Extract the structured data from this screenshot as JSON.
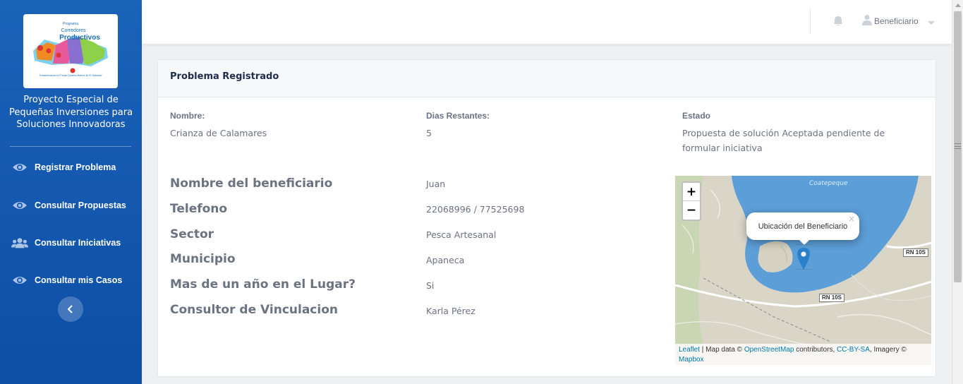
{
  "sidebar": {
    "logo": {
      "line1": "Programa",
      "line2": "Corredores",
      "line3": "Productivos",
      "tagline": "Transformando la Franja Costero-Marina de El Salvador"
    },
    "project_title": "Proyecto Especial de Pequeñas Inversiones para Soluciones Innovadoras",
    "items": [
      {
        "label": "Registrar Problema",
        "icon": "eye-icon"
      },
      {
        "label": "Consultar Propuestas",
        "icon": "eye-icon"
      },
      {
        "label": "Consultar Iniciativas",
        "icon": "users-icon"
      },
      {
        "label": "Consultar mis Casos",
        "icon": "eye-icon"
      }
    ],
    "collapse_icon": "chevron-left-icon"
  },
  "topbar": {
    "user_label": "Beneficiario",
    "bell_icon": "bell-icon",
    "user_icon": "user-icon"
  },
  "card": {
    "title": "Problema Registrado",
    "summary": [
      {
        "label": "Nombre:",
        "value": "Crianza de Calamares"
      },
      {
        "label": "Dias Restantes:",
        "value": "5"
      },
      {
        "label": "Estado",
        "value": "Propuesta de solución Aceptada pendiente de formular iniciativa"
      }
    ],
    "details": [
      {
        "label": "Nombre del beneficiario",
        "value": "Juan"
      },
      {
        "label": "Telefono",
        "value": "22068996 / 77525698"
      },
      {
        "label": "Sector",
        "value": "Pesca Artesanal"
      },
      {
        "label": "Municipio",
        "value": "Apaneca"
      },
      {
        "label": "Mas de un año en el Lugar?",
        "value": "Si"
      },
      {
        "label": "Consultor de Vinculacion",
        "value": "Karla Pérez"
      }
    ]
  },
  "map": {
    "zoom_in": "+",
    "zoom_out": "−",
    "popup_text": "Ubicación del Beneficiario",
    "popup_close": "×",
    "lake_label": "Coatepeque",
    "road_labels": [
      "RN 10S",
      "RN 10S"
    ],
    "attribution": {
      "leaflet": "Leaflet",
      "sep1": " | Map data © ",
      "osm": "OpenStreetMap",
      "sep2": " contributors, ",
      "license": "CC-BY-SA",
      "sep3": ", Imagery © ",
      "mapbox": "Mapbox"
    }
  },
  "colors": {
    "sidebar": "#1b62b9",
    "title_text": "#1f2d4d",
    "lake": "#5c9ed8",
    "marker": "#2a81cb"
  }
}
